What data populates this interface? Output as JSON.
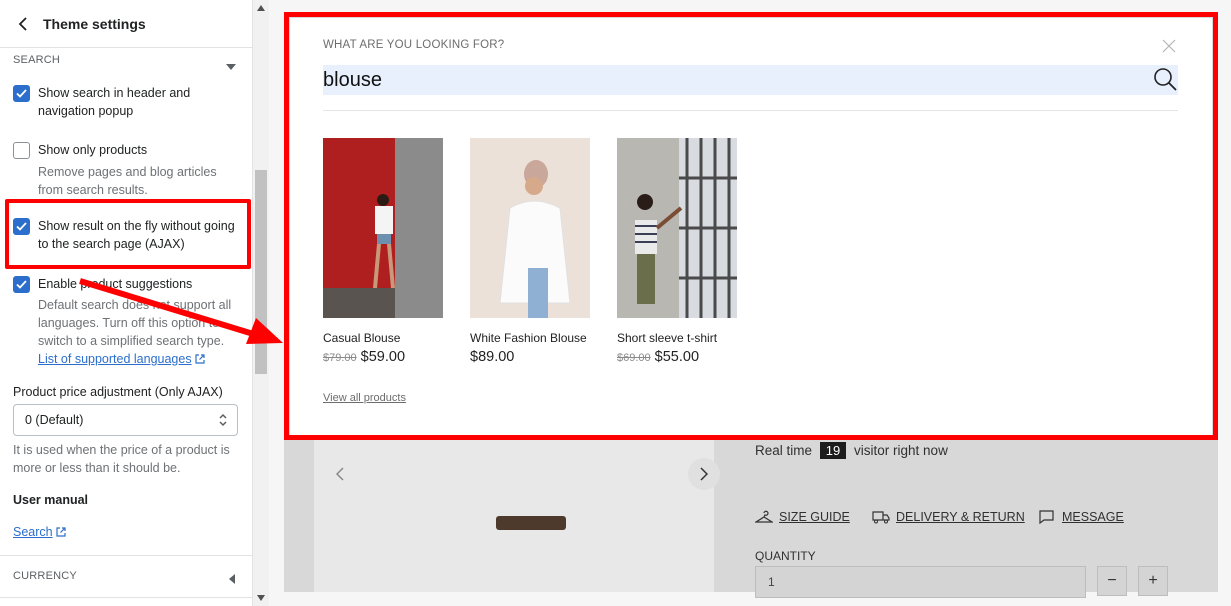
{
  "sidebar": {
    "title": "Theme settings",
    "section_search": "SEARCH",
    "options": [
      {
        "label": "Show search in header and navigation popup",
        "checked": true
      },
      {
        "label": "Show only products",
        "help": "Remove pages and blog articles from search results.",
        "checked": false
      },
      {
        "label": "Show result on the fly without going to the search page (AJAX)",
        "checked": true
      },
      {
        "label": "Enable product suggestions",
        "help": "Default search does not support all languages. Turn off this option to switch to a simplified search type.",
        "link": "List of supported languages",
        "checked": true
      }
    ],
    "price_adjust_label": "Product price adjustment (Only AJAX)",
    "price_adjust_value": "0 (Default)",
    "price_adjust_help": "It is used when the price of a product is more or less than it should be.",
    "user_manual_label": "User manual",
    "user_manual_link": "Search",
    "section_currency": "CURRENCY"
  },
  "search_popup": {
    "label": "WHAT ARE YOU LOOKING FOR?",
    "query": "blouse",
    "products": [
      {
        "name": "Casual Blouse",
        "old_price": "$79.00",
        "price": "$59.00"
      },
      {
        "name": "White Fashion Blouse",
        "old_price": "",
        "price": "$89.00"
      },
      {
        "name": "Short sleeve t-shirt",
        "old_price": "$69.00",
        "price": "$55.00"
      }
    ],
    "view_all": "View all products"
  },
  "product_page": {
    "visitor_prefix": "Real time",
    "visitor_count": "19",
    "visitor_suffix": "visitor right now",
    "links": [
      "SIZE GUIDE",
      "DELIVERY & RETURN",
      "MESSAGE"
    ],
    "quantity_label": "QUANTITY",
    "quantity_value": "1",
    "minus": "−",
    "plus": "+"
  },
  "colors": {
    "accent": "#2c6ecb",
    "annotation": "#ff0000"
  }
}
